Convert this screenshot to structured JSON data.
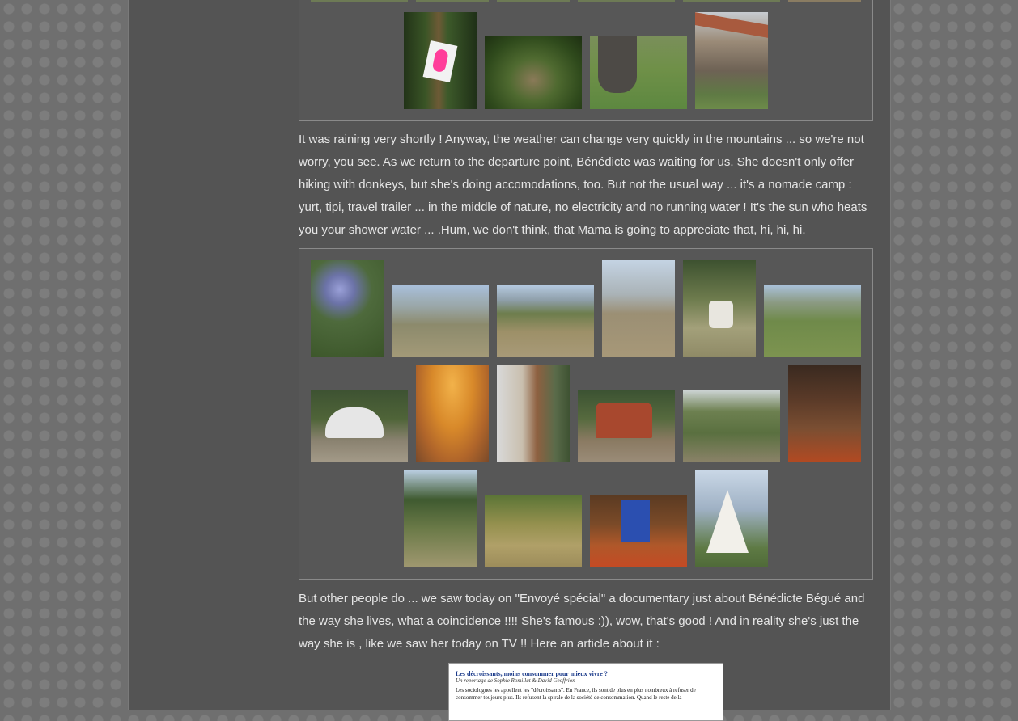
{
  "paragraphs": {
    "p1": "It was raining very shortly ! Anyway, the weather can change very quickly in the mountains ... so we're not worry, you see. As we return to the departure point, Bénédicte was waiting for us. She doesn't only offer hiking with donkeys, but she's doing accomodations, too. But not the usual way ... it's a nomade camp : yurt, tipi, travel trailer ... in the middle of nature, no electricity and no running water ! It's the sun who heats you your shower water ... .Hum, we don't think, that Mama is going to appreciate that, hi, hi, hi.",
    "p2": "But other people do ... we saw today on \"Envoyé spécial\" a documentary just about Bénédicte Bégué and the way she lives, what a coincidence !!!! She's famous :)), wow, that's good ! And in reality she's just the way she is , like we saw her today on TV !! Here an article about it :"
  },
  "article": {
    "headline": "Les décroissants, moins consommer pour mieux vivre ?",
    "byline": "Un reportage de Sophie Romillat & David Geoffrion",
    "body": "Les sociologues les appellent les \"décroissants\". En France, ils sont de plus en plus nombreux à refuser de consommer toujours plus. Ils refusent la spirale de la société de consommation. Quand le reste de la"
  },
  "colors": {
    "page_bg": "#545454",
    "text": "#e6e6e6"
  }
}
